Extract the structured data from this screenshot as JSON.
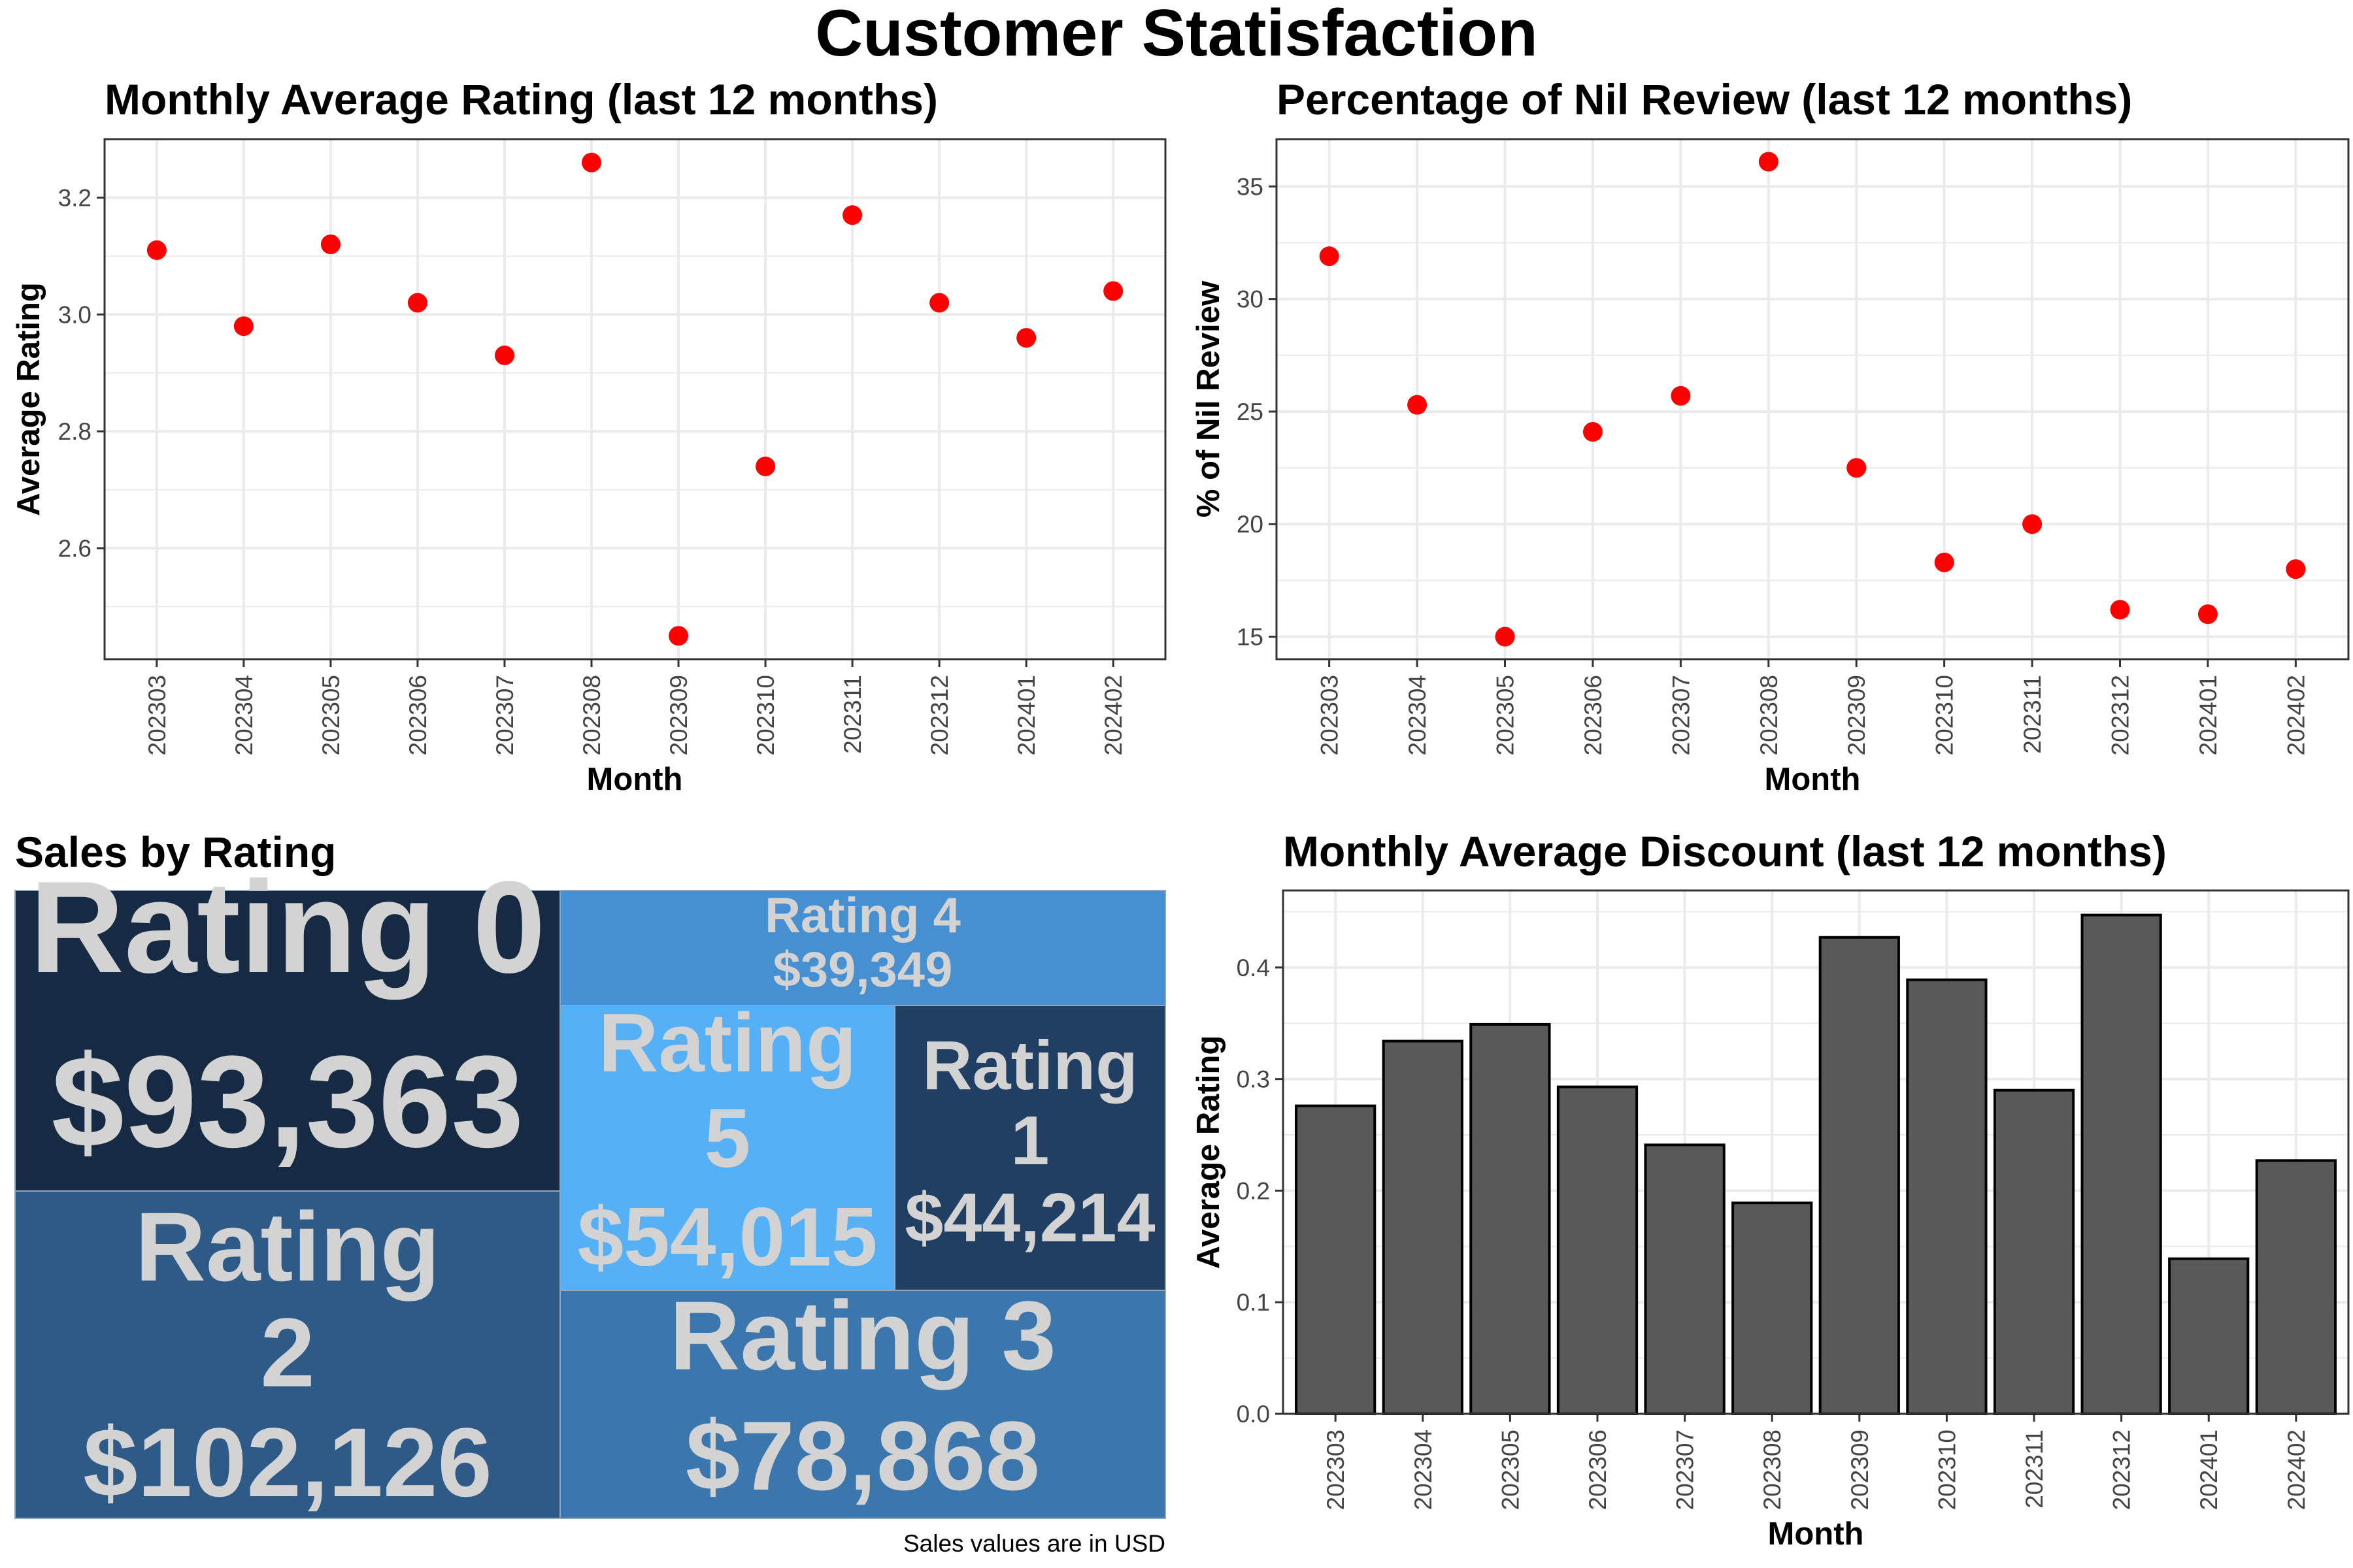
{
  "title": "Customer Statisfaction",
  "caption": "Sales values are in USD",
  "colors": {
    "point": "#ff0000",
    "bar_fill": "#595959",
    "bar_stroke": "#000000",
    "grid": "#ebebeb",
    "tile_text": "#d3d3d3",
    "tile_border": "#8fa8c0"
  },
  "chart_data": [
    {
      "id": "avg_rating",
      "type": "scatter",
      "title": "Monthly Average Rating (last 12 months)",
      "xlabel": "Month",
      "ylabel": "Average Rating",
      "categories": [
        "202303",
        "202304",
        "202305",
        "202306",
        "202307",
        "202308",
        "202309",
        "202310",
        "202311",
        "202312",
        "202401",
        "202402"
      ],
      "values": [
        3.11,
        2.98,
        3.12,
        3.02,
        2.93,
        3.26,
        2.45,
        2.74,
        3.17,
        3.02,
        2.96,
        3.04
      ],
      "ylim": [
        2.41,
        3.3
      ],
      "yticks": [
        2.6,
        2.8,
        3.0,
        3.2
      ],
      "ytick_labels": [
        "2.6",
        "2.8",
        "3.0",
        "3.2"
      ],
      "grid": true
    },
    {
      "id": "nil_review",
      "type": "scatter",
      "title": "Percentage of Nil Review (last 12 months)",
      "xlabel": "Month",
      "ylabel": "% of Nil Review",
      "categories": [
        "202303",
        "202304",
        "202305",
        "202306",
        "202307",
        "202308",
        "202309",
        "202310",
        "202311",
        "202312",
        "202401",
        "202402"
      ],
      "values": [
        31.9,
        25.3,
        15.0,
        24.1,
        25.7,
        36.1,
        22.5,
        18.3,
        20.0,
        16.2,
        16.0,
        18.0
      ],
      "ylim": [
        14.0,
        37.1
      ],
      "yticks": [
        15,
        20,
        25,
        30,
        35
      ],
      "ytick_labels": [
        "15",
        "20",
        "25",
        "30",
        "35"
      ],
      "grid": true
    },
    {
      "id": "sales_by_rating",
      "type": "treemap",
      "title": "Sales by Rating",
      "tiles": [
        {
          "label": "Rating 0",
          "value": 93363,
          "value_text": "$93,363",
          "color": "#172a44"
        },
        {
          "label": "Rating 2",
          "value": 102126,
          "value_text": "$102,126",
          "color": "#2d5a86"
        },
        {
          "label": "Rating 4",
          "value": 39349,
          "value_text": "$39,349",
          "color": "#4690d2"
        },
        {
          "label": "Rating 5",
          "value": 54015,
          "value_text": "$54,015",
          "color": "#56b0f6"
        },
        {
          "label": "Rating 1",
          "value": 44214,
          "value_text": "$44,214",
          "color": "#203f62"
        },
        {
          "label": "Rating 3",
          "value": 78868,
          "value_text": "$78,868",
          "color": "#3b77ac"
        }
      ]
    },
    {
      "id": "avg_discount",
      "type": "bar",
      "title": "Monthly Average Discount (last 12 months)",
      "xlabel": "Month",
      "ylabel": "Average Rating",
      "categories": [
        "202303",
        "202304",
        "202305",
        "202306",
        "202307",
        "202308",
        "202309",
        "202310",
        "202311",
        "202312",
        "202401",
        "202402"
      ],
      "values": [
        0.276,
        0.334,
        0.349,
        0.293,
        0.241,
        0.189,
        0.427,
        0.389,
        0.29,
        0.447,
        0.139,
        0.227
      ],
      "ylim": [
        0.0,
        0.469
      ],
      "yticks": [
        0.0,
        0.1,
        0.2,
        0.3,
        0.4
      ],
      "ytick_labels": [
        "0.0",
        "0.1",
        "0.2",
        "0.3",
        "0.4"
      ],
      "grid": true
    }
  ]
}
